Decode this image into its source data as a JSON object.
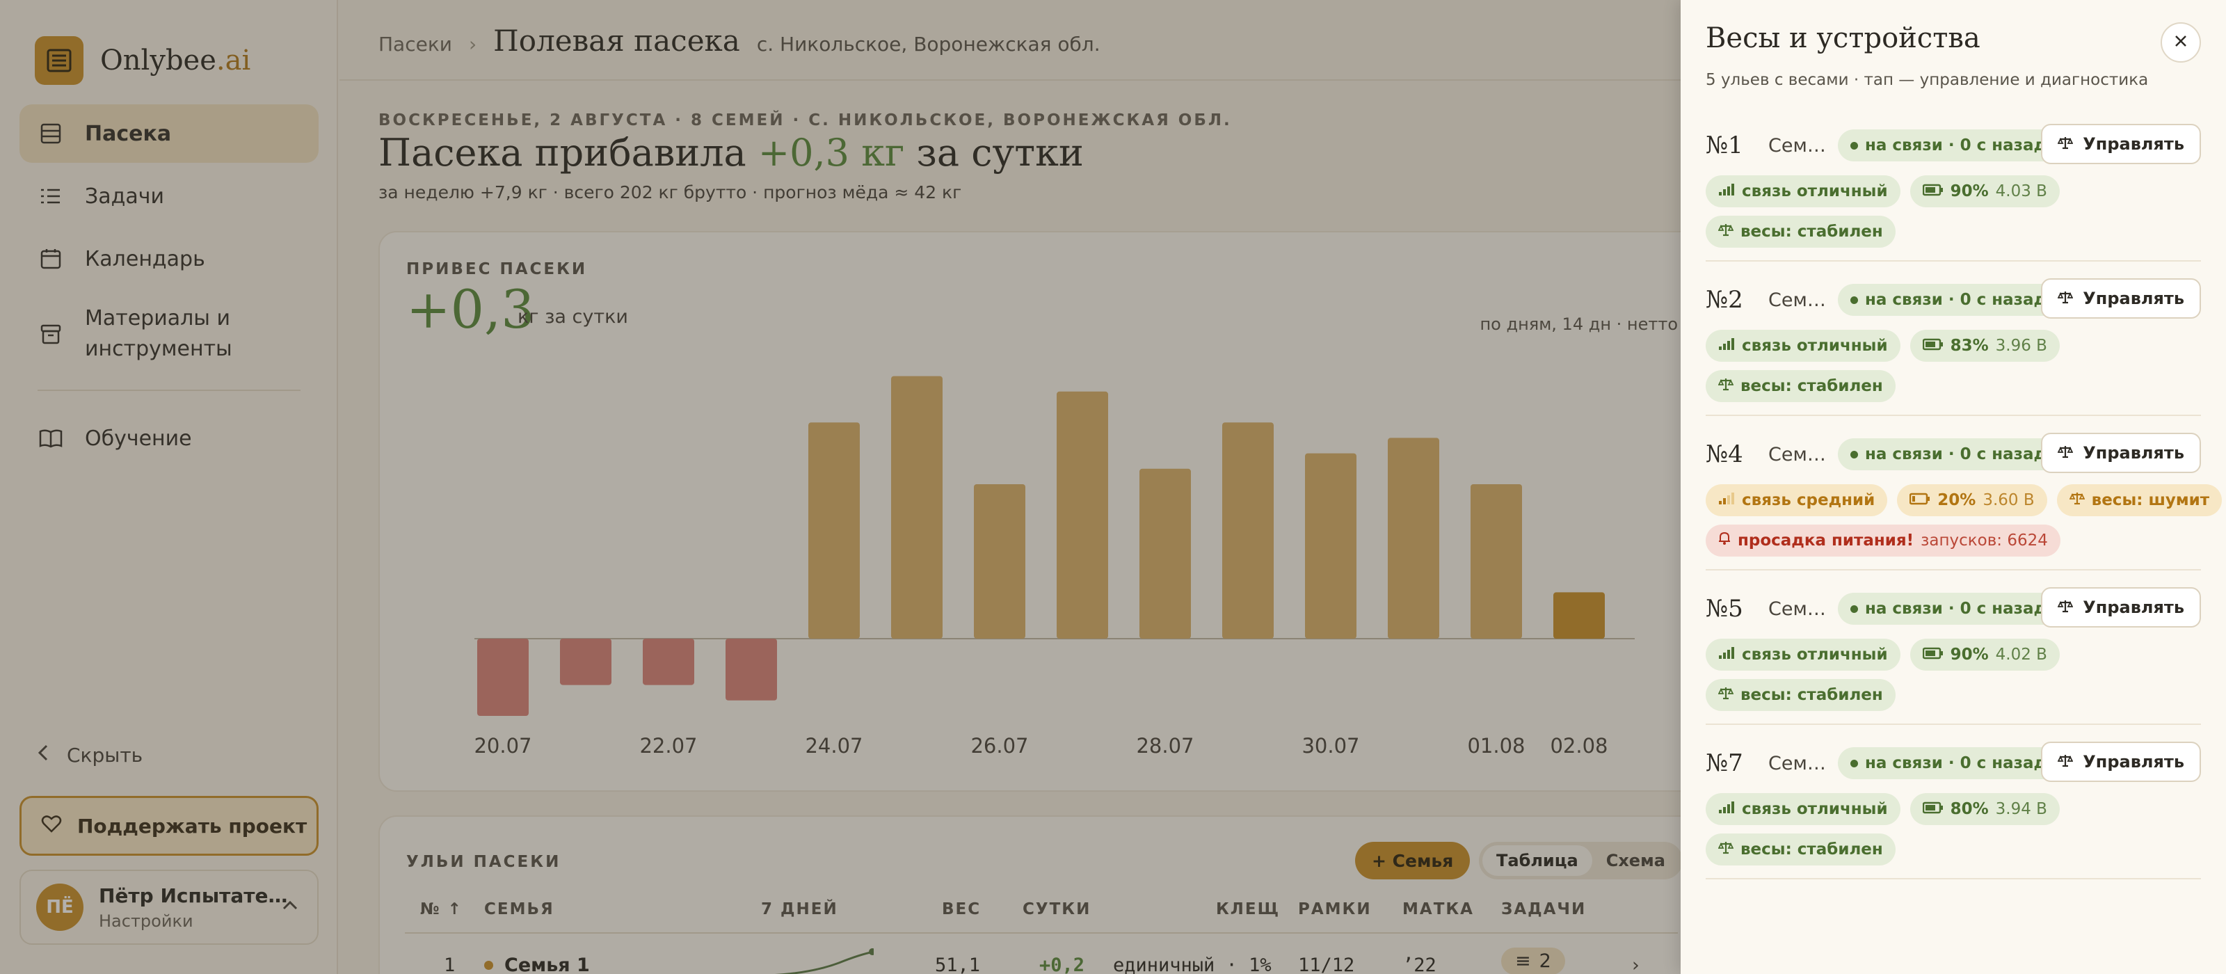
{
  "brand": {
    "name": "Onlybee",
    "suffix": ".ai"
  },
  "sidebar": {
    "items": [
      {
        "label": "Пасека",
        "icon": "apiary-icon"
      },
      {
        "label": "Задачи",
        "icon": "tasks-icon"
      },
      {
        "label": "Календарь",
        "icon": "calendar-icon"
      },
      {
        "label": "Материалы и инструменты",
        "icon": "box-icon"
      },
      {
        "label": "Обучение",
        "icon": "book-icon"
      }
    ],
    "hide_label": "Скрыть",
    "support_label": "Поддержать проект",
    "user": {
      "initials": "ПЁ",
      "name": "Пётр Испытате…",
      "sub": "Настройки"
    }
  },
  "breadcrumb": {
    "root": "Пасеки",
    "sep": "›",
    "title": "Полевая пасека",
    "location": "с. Никольское, Воронежская обл."
  },
  "summary": {
    "dateline": "ВОСКРЕСЕНЬЕ, 2 АВГУСТА · 8 СЕМЕЙ · С. НИКОЛЬСКОЕ, ВОРОНЕЖСКАЯ ОБЛ.",
    "headline_pre": "Пасека прибавила ",
    "headline_gain": "+0,3 кг",
    "headline_post": " за сутки",
    "subline": "за неделю +7,9 кг · всего 202 кг брутто · прогноз мёда ≈ 42 кг"
  },
  "chart_card": {
    "label": "ПРИВЕС ПАСЕКИ",
    "value": "+0,3",
    "unit": "кг за сутки",
    "note": "по дням, 14 дн · нетто"
  },
  "chart_data": {
    "type": "bar",
    "categories": [
      "20.07",
      "21.07",
      "22.07",
      "23.07",
      "24.07",
      "25.07",
      "26.07",
      "27.07",
      "28.07",
      "29.07",
      "30.07",
      "31.07",
      "01.08",
      "02.08"
    ],
    "tick_labels": [
      "20.07",
      "",
      "22.07",
      "",
      "24.07",
      "",
      "26.07",
      "",
      "28.07",
      "",
      "30.07",
      "",
      "01.08",
      "02.08"
    ],
    "values": [
      -0.5,
      -0.3,
      -0.3,
      -0.4,
      1.4,
      1.7,
      1.0,
      1.6,
      1.1,
      1.4,
      1.2,
      1.3,
      1.0,
      0.3
    ],
    "ylim": [
      -0.6,
      1.8
    ],
    "grid": false,
    "colors": {
      "positive": "#d8b06a",
      "negative": "#d9837a",
      "current": "#c9902a"
    }
  },
  "hives_table": {
    "title": "УЛЬИ ПАСЕКИ",
    "add_label": "+ Семья",
    "views": [
      "Таблица",
      "Схема"
    ],
    "columns": [
      "№ ↑",
      "СЕМЬЯ",
      "7 ДНЕЙ",
      "ВЕС",
      "СУТКИ",
      "КЛЕЩ",
      "РАМКИ",
      "МАТКА",
      "ЗАДАЧИ"
    ],
    "row": {
      "num": "1",
      "family": "Семья 1",
      "weight": "51,1",
      "day": "+0,2",
      "mite": "единичный · 1%",
      "frames": "11/12",
      "queen": "’22",
      "tasks": "2"
    }
  },
  "panel": {
    "title": "Весы и устройства",
    "subtitle": "5 ульев с весами · тап — управление и диагностика",
    "manage_label": "Управлять",
    "devices": [
      {
        "num": "№1",
        "family": "Сем…",
        "status": "на связи · 0 с назад",
        "signal": "связь отличный",
        "battery": "90%",
        "voltage": "4.03 В",
        "scale": "весы: стабилен",
        "warn": false
      },
      {
        "num": "№2",
        "family": "Сем…",
        "status": "на связи · 0 с назад",
        "signal": "связь отличный",
        "battery": "83%",
        "voltage": "3.96 В",
        "scale": "весы: стабилен",
        "warn": false
      },
      {
        "num": "№4",
        "family": "Сем…",
        "status": "на связи · 0 с назад",
        "signal": "связь средний",
        "battery": "20%",
        "voltage": "3.60 В",
        "scale": "весы: шумит",
        "warn": true,
        "alert": "просадка питания!",
        "alert_extra": "запусков: 6624"
      },
      {
        "num": "№5",
        "family": "Сем…",
        "status": "на связи · 0 с назад",
        "signal": "связь отличный",
        "battery": "90%",
        "voltage": "4.02 В",
        "scale": "весы: стабилен",
        "warn": false
      },
      {
        "num": "№7",
        "family": "Сем…",
        "status": "на связи · 0 с назад",
        "signal": "связь отличный",
        "battery": "80%",
        "voltage": "3.94 В",
        "scale": "весы: стабилен",
        "warn": false
      }
    ]
  }
}
